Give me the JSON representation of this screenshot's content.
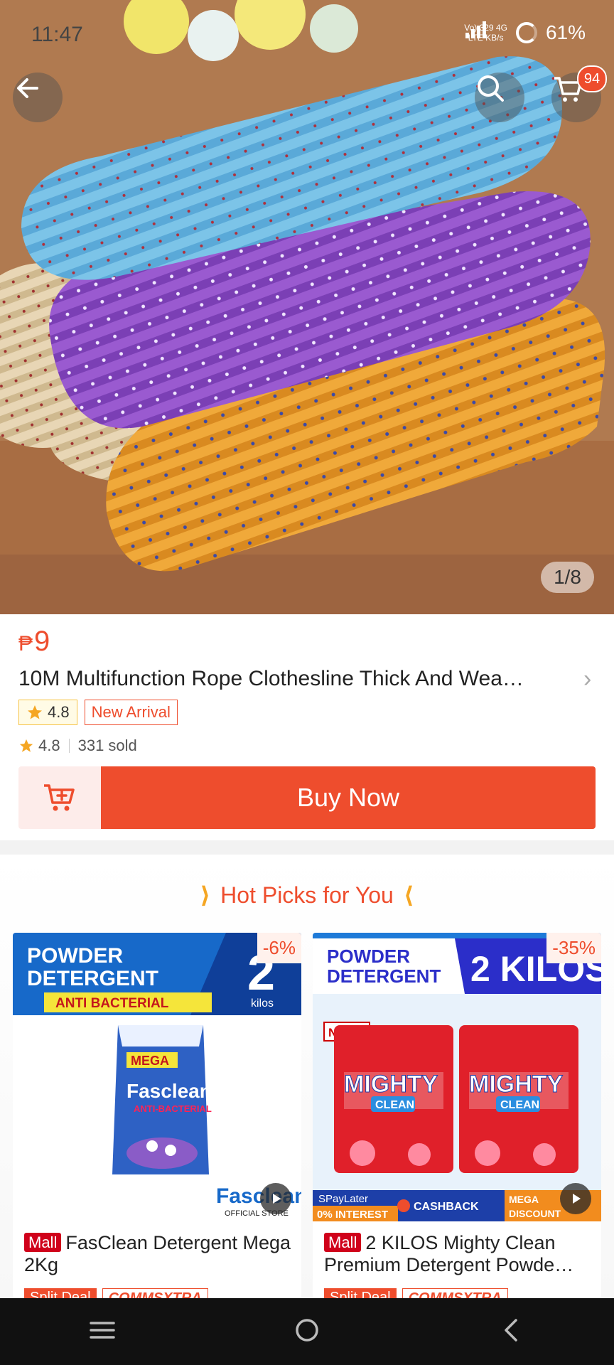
{
  "status_bar": {
    "time": "11:47",
    "network_top": "Vo) 329 4G",
    "network_bottom": "LTE KB/s",
    "battery": "61%"
  },
  "hero": {
    "image_counter": "1/8",
    "cart_count": "94"
  },
  "product": {
    "currency": "₱",
    "price": "9",
    "title": "10M Multifunction Rope Clothesline Thick And Wea…",
    "rating_badge": "4.8",
    "new_arrival": "New Arrival",
    "rating": "4.8",
    "sold": "331 sold",
    "buy_now": "Buy Now"
  },
  "hot_picks": {
    "title": "Hot Picks for You",
    "items": [
      {
        "discount": "-6%",
        "mall": "Mall",
        "name": "FasClean Detergent Mega 2Kg",
        "tag1": "Split Deal",
        "tag2": "COMMSXTRA",
        "banner1": "POWDER",
        "banner2": "DETERGENT",
        "banner3": "ANTI BACTERIAL",
        "big": "2",
        "unit": "kilos",
        "brand": "Fasclean",
        "pack_label": "MEGA",
        "pack_sub": "ANTI-BACTERIAL",
        "store": "OFFICIAL STORE"
      },
      {
        "discount": "-35%",
        "mall": "Mall",
        "name": "2 KILOS Mighty Clean Premium Detergent Powde…",
        "tag1": "Split Deal",
        "tag2": "COMMSXTRA",
        "banner1": "POWDER",
        "banner2": "DETERGENT",
        "big": "2 KILOS",
        "new_label": "NEW!",
        "brand1": "MIGHTY",
        "brand2": "CLEAN",
        "promo1": "SPayLater",
        "promo2": "0% INTEREST",
        "promo3": "CASHBACK",
        "promo4": "MEGA DISCOUNT"
      }
    ]
  },
  "colors": {
    "accent": "#ee4d2d",
    "mall": "#d0011b",
    "star": "#f6c343"
  }
}
